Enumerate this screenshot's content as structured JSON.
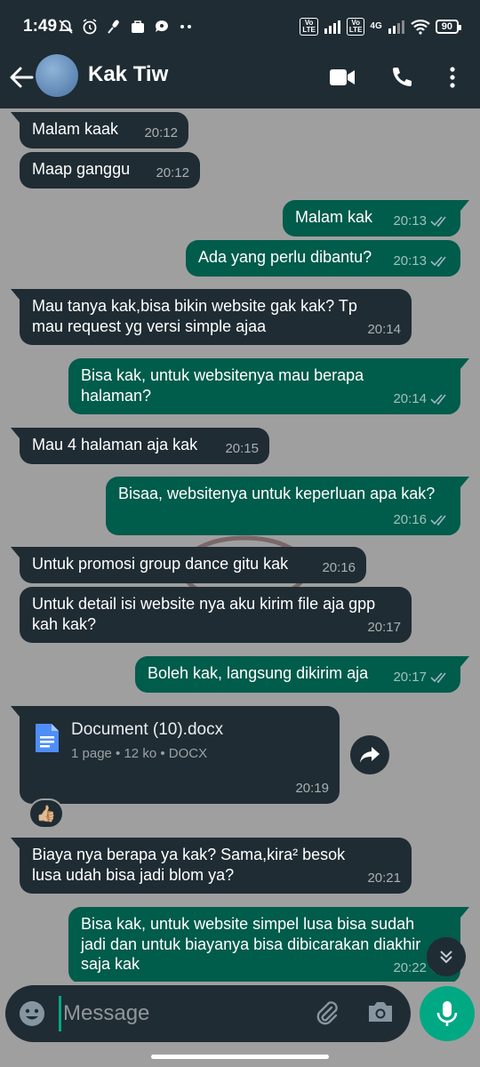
{
  "status_bar": {
    "time": "1:49",
    "volte_label": "Vo\nLTE",
    "network": "4G",
    "battery": "90"
  },
  "header": {
    "contact_name": "Kak Tiw",
    "icons": [
      "back-arrow-icon",
      "video-call-icon",
      "voice-call-icon",
      "more-vert-icon"
    ]
  },
  "colors": {
    "header_bg": "#1f2c34",
    "incoming_bubble": "#1f2c34",
    "outgoing_bubble": "#005c4b",
    "accent": "#00a884",
    "chat_bg": "#9f9f9f"
  },
  "messages": [
    {
      "dir": "in",
      "text": "Malam kaak",
      "time": "20:12"
    },
    {
      "dir": "in",
      "text": "Maap ganggu",
      "time": "20:12"
    },
    {
      "dir": "out",
      "text": "Malam kak",
      "time": "20:13",
      "status": "read"
    },
    {
      "dir": "out",
      "text": "Ada yang perlu dibantu?",
      "time": "20:13",
      "status": "read"
    },
    {
      "dir": "in",
      "text": "Mau tanya kak,bisa bikin website gak kak? Tp mau request yg versi simple ajaa",
      "time": "20:14"
    },
    {
      "dir": "out",
      "text": "Bisa kak, untuk websitenya mau berapa halaman?",
      "time": "20:14",
      "status": "read"
    },
    {
      "dir": "in",
      "text": "Mau 4 halaman aja kak",
      "time": "20:15"
    },
    {
      "dir": "out",
      "text": "Bisaa, websitenya untuk keperluan apa kak?",
      "time": "20:16",
      "status": "read"
    },
    {
      "dir": "in",
      "text": "Untuk promosi group dance gitu kak",
      "time": "20:16"
    },
    {
      "dir": "in",
      "text": "Untuk detail isi website nya aku kirim file aja gpp kah kak?",
      "time": "20:17"
    },
    {
      "dir": "out",
      "text": "Boleh kak, langsung dikirim aja",
      "time": "20:17",
      "status": "read"
    },
    {
      "dir": "in",
      "type": "document",
      "doc_name": "Document (10).docx",
      "doc_info": "1 page • 12 ko • DOCX",
      "time": "20:19",
      "reaction": "👍🏼"
    },
    {
      "dir": "in",
      "text": "Biaya nya berapa ya kak? Sama,kira² besok lusa udah bisa jadi blom ya?",
      "time": "20:21"
    },
    {
      "dir": "out",
      "text": "Bisa kak, untuk website simpel lusa bisa sudah jadi dan untuk biayanya bisa dibicarakan diakhir saja kak",
      "time": "20:22",
      "status": "read"
    }
  ],
  "composer": {
    "placeholder": "Message",
    "icons": [
      "emoji-icon",
      "attach-icon",
      "camera-icon",
      "mic-icon"
    ]
  }
}
